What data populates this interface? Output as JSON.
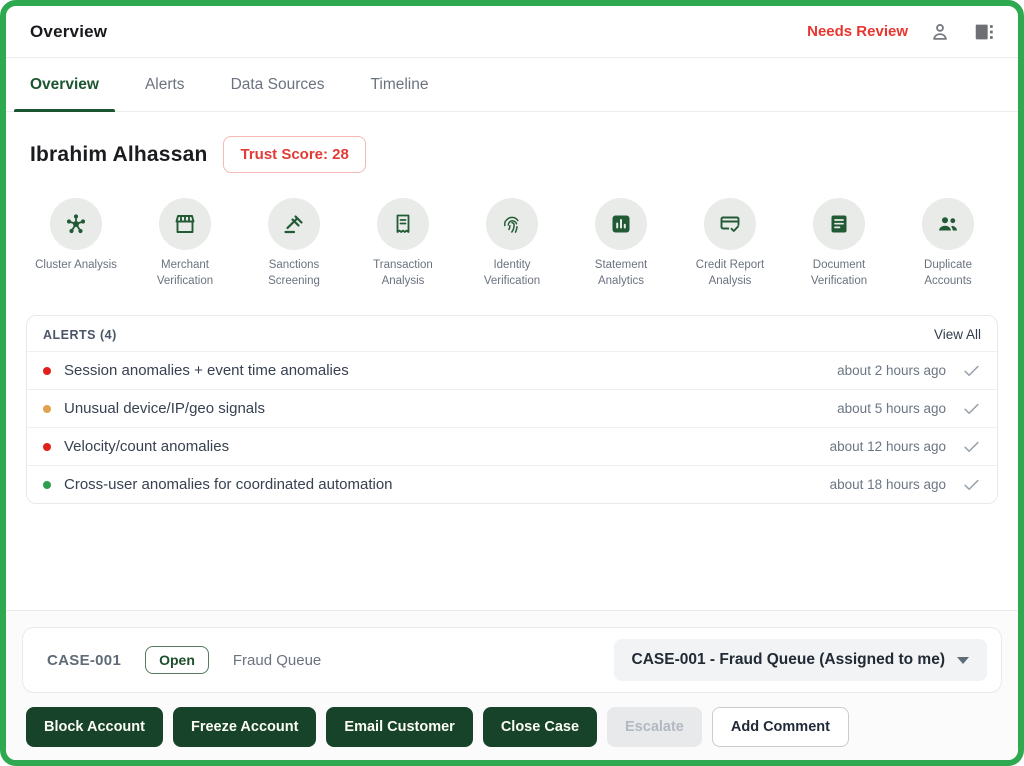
{
  "theme": {
    "border_green": "#2fa94f",
    "dark_green": "#17432a",
    "icon_green": "#235a36",
    "alert_red": "#e23b36"
  },
  "header": {
    "title": "Overview",
    "status": "Needs Review"
  },
  "tabs": [
    {
      "label": "Overview",
      "active": true
    },
    {
      "label": "Alerts",
      "active": false
    },
    {
      "label": "Data Sources",
      "active": false
    },
    {
      "label": "Timeline",
      "active": false
    }
  ],
  "customer": {
    "name": "Ibrahim Alhassan",
    "trust_score": "Trust Score: 28"
  },
  "services": [
    {
      "label": "Cluster Analysis",
      "icon": "cluster-icon"
    },
    {
      "label": "Merchant Verification",
      "icon": "storefront-icon"
    },
    {
      "label": "Sanctions Screening",
      "icon": "gavel-icon"
    },
    {
      "label": "Transaction Analysis",
      "icon": "receipt-icon"
    },
    {
      "label": "Identity Verification",
      "icon": "fingerprint-icon"
    },
    {
      "label": "Statement Analytics",
      "icon": "bar-chart-icon"
    },
    {
      "label": "Credit Report Analysis",
      "icon": "credit-card-check-icon"
    },
    {
      "label": "Document Verification",
      "icon": "document-icon"
    },
    {
      "label": "Duplicate Accounts",
      "icon": "people-icon"
    }
  ],
  "alerts": {
    "title": "ALERTS (4)",
    "view_all": "View All",
    "items": [
      {
        "text": "Session anomalies + event time anomalies",
        "time": "about 2 hours ago",
        "severity_color": "#e0211a"
      },
      {
        "text": "Unusual device/IP/geo signals",
        "time": "about 5 hours ago",
        "severity_color": "#e1a14f"
      },
      {
        "text": "Velocity/count anomalies",
        "time": "about 12 hours ago",
        "severity_color": "#e0211a"
      },
      {
        "text": "Cross-user anomalies for coordinated automation",
        "time": "about 18 hours ago",
        "severity_color": "#2e9e4e"
      }
    ]
  },
  "case_bar": {
    "case_id": "CASE-001",
    "status": "Open",
    "queue": "Fraud Queue",
    "selector": "CASE-001 - Fraud Queue (Assigned to me)"
  },
  "actions": {
    "block": "Block Account",
    "freeze": "Freeze Account",
    "email": "Email Customer",
    "close": "Close Case",
    "escalate": "Escalate",
    "comment": "Add Comment"
  }
}
